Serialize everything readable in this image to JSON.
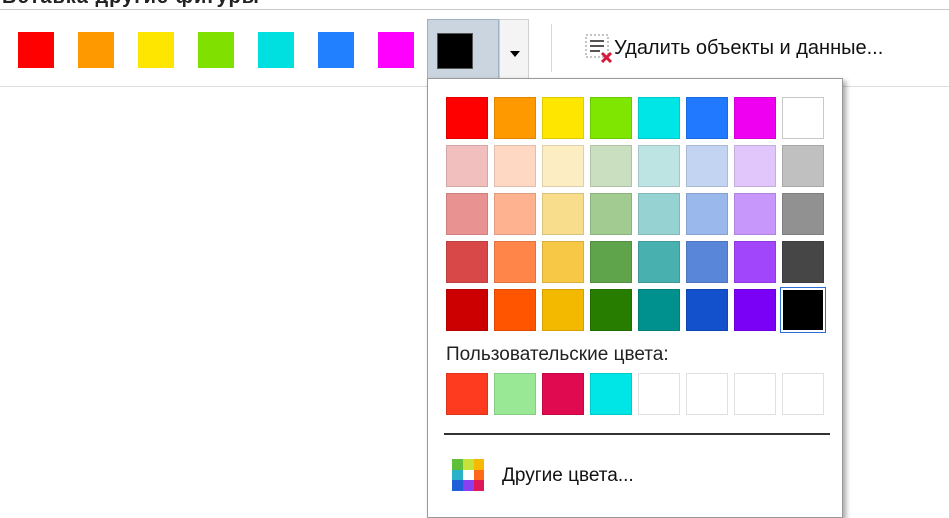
{
  "window_title_fragment": "Вставка другие фигуры",
  "toolbar": {
    "quick_colors": [
      "#ff0000",
      "#ff9900",
      "#ffe600",
      "#80e000",
      "#00e0e0",
      "#2080ff",
      "#ff00ff"
    ],
    "current_color": "#000000",
    "delete_label": "Удалить объекты и данные..."
  },
  "palette": {
    "rows": [
      [
        "#ff0000",
        "#ff9900",
        "#ffe600",
        "#7ee600",
        "#00e6e6",
        "#2079ff",
        "#f000f0",
        "#ffffff"
      ],
      [
        "#f2bfbf",
        "#ffd8c4",
        "#fdedc2",
        "#c9dfbf",
        "#bde3e3",
        "#c3d4f2",
        "#e0c6fb",
        "#c0c0c0"
      ],
      [
        "#e99292",
        "#ffb290",
        "#f8de8c",
        "#a2cb91",
        "#96d2d2",
        "#9ab8ec",
        "#c897fc",
        "#919191"
      ],
      [
        "#d94848",
        "#ff8548",
        "#f6c845",
        "#5fa34a",
        "#49b0b0",
        "#5986d9",
        "#a246fb",
        "#464646"
      ],
      [
        "#cc0000",
        "#ff5500",
        "#f3b800",
        "#267d00",
        "#00918f",
        "#1250cc",
        "#7a00f6",
        "#000000"
      ]
    ],
    "selected_index": [
      4,
      7
    ],
    "custom_label": "Пользовательские цвета:",
    "custom_colors": [
      "#ff3b1f",
      "#99e896",
      "#e00a50",
      "#00e6e6",
      "",
      "",
      "",
      ""
    ],
    "more_colors_label": "Другие цвета..."
  }
}
